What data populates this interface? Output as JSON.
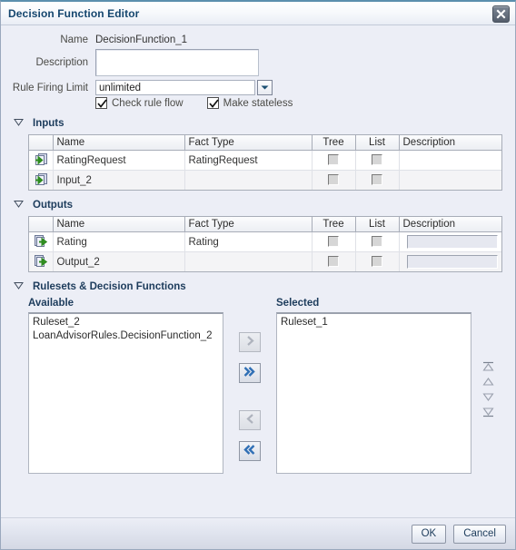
{
  "dialog": {
    "title": "Decision Function Editor",
    "close_icon": "close-icon"
  },
  "form": {
    "name_label": "Name",
    "name_value": "DecisionFunction_1",
    "description_label": "Description",
    "description_value": "",
    "description_placeholder": "",
    "rule_firing_limit_label": "Rule Firing Limit",
    "rule_firing_limit_value": "unlimited",
    "dropdown_icon": "chevron-down-icon",
    "check_rule_flow_label": "Check rule flow",
    "check_rule_flow_checked": true,
    "make_stateless_label": "Make stateless",
    "make_stateless_checked": true
  },
  "inputs": {
    "section_title": "Inputs",
    "expanded": true,
    "columns": [
      "",
      "Name",
      "Fact Type",
      "Tree",
      "List",
      "Description"
    ],
    "rows": [
      {
        "icon": "input-arrow-icon",
        "name": "RatingRequest",
        "fact_type": "RatingRequest",
        "tree": false,
        "list": false,
        "description": ""
      },
      {
        "icon": "input-arrow-icon",
        "name": "Input_2",
        "fact_type": "",
        "tree": false,
        "list": false,
        "description": ""
      }
    ]
  },
  "outputs": {
    "section_title": "Outputs",
    "expanded": true,
    "columns": [
      "",
      "Name",
      "Fact Type",
      "Tree",
      "List",
      "Description"
    ],
    "rows": [
      {
        "icon": "output-arrow-icon",
        "name": "Rating",
        "fact_type": "Rating",
        "tree": false,
        "list": false,
        "description": ""
      },
      {
        "icon": "output-arrow-icon",
        "name": "Output_2",
        "fact_type": "",
        "tree": false,
        "list": false,
        "description": ""
      }
    ]
  },
  "rulesets": {
    "section_title": "Rulesets & Decision Functions",
    "expanded": true,
    "available_label": "Available",
    "available_items": [
      "Ruleset_2",
      "LoanAdvisorRules.DecisionFunction_2"
    ],
    "selected_label": "Selected",
    "selected_items": [
      "Ruleset_1"
    ],
    "shuttle_buttons": [
      {
        "name": "move-right-button",
        "icon": "chevron-right-icon",
        "enabled": false
      },
      {
        "name": "move-all-right-button",
        "icon": "chevron-double-right-icon",
        "enabled": true
      },
      {
        "name": "move-left-button",
        "icon": "chevron-left-icon",
        "enabled": false
      },
      {
        "name": "move-all-left-button",
        "icon": "chevron-double-left-icon",
        "enabled": true
      }
    ],
    "reorder_buttons": [
      {
        "name": "move-to-top-button",
        "icon": "move-to-top-icon"
      },
      {
        "name": "move-up-button",
        "icon": "move-up-icon"
      },
      {
        "name": "move-down-button",
        "icon": "move-down-icon"
      },
      {
        "name": "move-to-bottom-button",
        "icon": "move-to-bottom-icon"
      }
    ]
  },
  "footer": {
    "ok_label": "OK",
    "cancel_label": "Cancel"
  },
  "colors": {
    "dialog_bg": "#eceef6",
    "title_accent": "#5b8fae",
    "heading_text": "#1d3c5c",
    "arrow_blue": "#2f6fb5",
    "arrow_green": "#4ca832"
  }
}
